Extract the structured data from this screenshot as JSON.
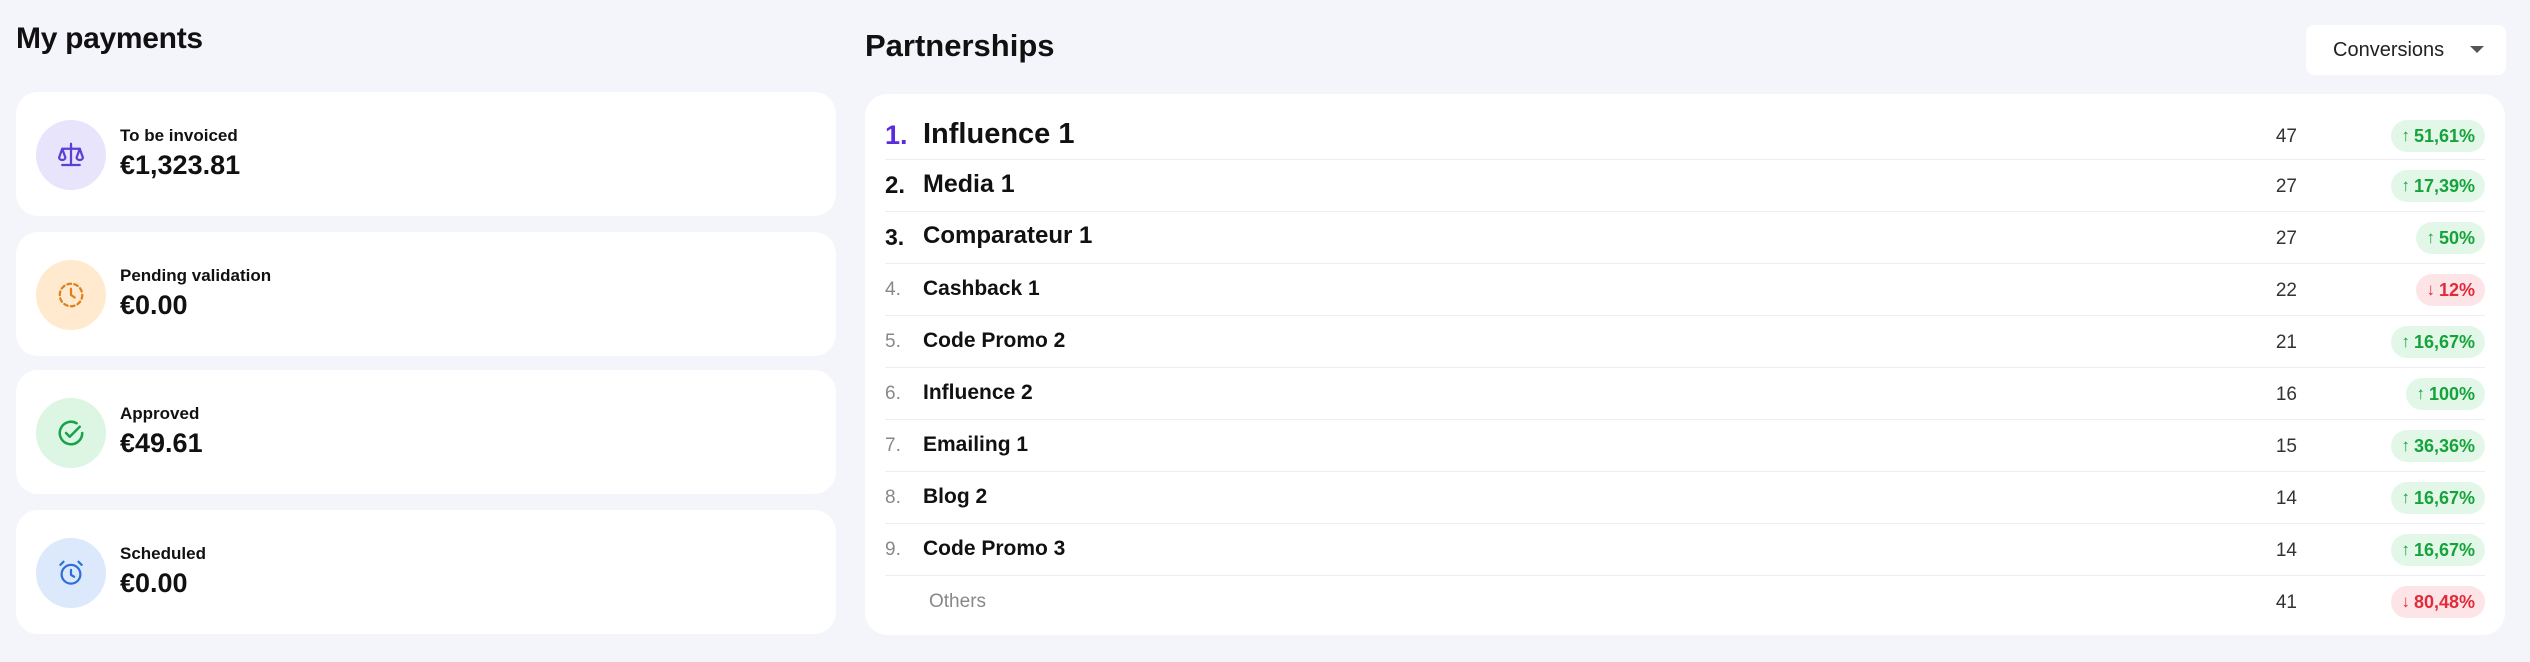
{
  "payments": {
    "title": "My payments",
    "cards": [
      {
        "label": "To be invoiced",
        "amount": "€1,323.81",
        "icon": "scale-icon",
        "bg": "#e7e4fb",
        "color": "#5b3fd6"
      },
      {
        "label": "Pending validation",
        "amount": "€0.00",
        "icon": "clock-dashed-icon",
        "bg": "#ffeacf",
        "color": "#e0801c"
      },
      {
        "label": "Approved",
        "amount": "€49.61",
        "icon": "check-circle-icon",
        "bg": "#ddf5e3",
        "color": "#16a34a"
      },
      {
        "label": "Scheduled",
        "amount": "€0.00",
        "icon": "alarm-clock-icon",
        "bg": "#dce8fb",
        "color": "#2f6fdc"
      }
    ]
  },
  "partnerships": {
    "title": "Partnerships",
    "dropdown": {
      "selected": "Conversions"
    },
    "rows": [
      {
        "rank": "1.",
        "name": "Influence 1",
        "count": "47",
        "change": "51,61%",
        "trend": "up"
      },
      {
        "rank": "2.",
        "name": "Media 1",
        "count": "27",
        "change": "17,39%",
        "trend": "up"
      },
      {
        "rank": "3.",
        "name": "Comparateur 1",
        "count": "27",
        "change": "50%",
        "trend": "up"
      },
      {
        "rank": "4.",
        "name": "Cashback 1",
        "count": "22",
        "change": "12%",
        "trend": "down"
      },
      {
        "rank": "5.",
        "name": "Code Promo 2",
        "count": "21",
        "change": "16,67%",
        "trend": "up"
      },
      {
        "rank": "6.",
        "name": "Influence 2",
        "count": "16",
        "change": "100%",
        "trend": "up"
      },
      {
        "rank": "7.",
        "name": "Emailing 1",
        "count": "15",
        "change": "36,36%",
        "trend": "up"
      },
      {
        "rank": "8.",
        "name": "Blog 2",
        "count": "14",
        "change": "16,67%",
        "trend": "up"
      },
      {
        "rank": "9.",
        "name": "Code Promo 3",
        "count": "14",
        "change": "16,67%",
        "trend": "up"
      },
      {
        "rank": "",
        "name": "Others",
        "count": "41",
        "change": "80,48%",
        "trend": "down"
      }
    ]
  },
  "colors": {
    "accent": "#5b2be0",
    "up_bg": "#e3f7e8",
    "up_fg": "#15a33b",
    "down_bg": "#fde5e7",
    "down_fg": "#e12b3a"
  }
}
